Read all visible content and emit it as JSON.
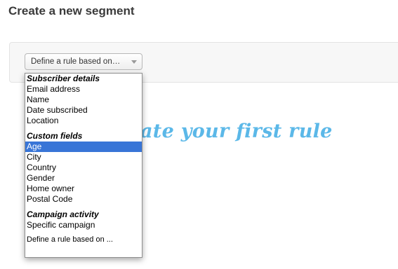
{
  "page": {
    "title": "Create a new segment"
  },
  "rule_select": {
    "value": "Define a rule based on…"
  },
  "hint_text": "ate your first rule",
  "dropdown": {
    "groups": [
      {
        "label": "Subscriber details",
        "options": [
          "Email address",
          "Name",
          "Date subscribed",
          "Location"
        ]
      },
      {
        "label": "Custom fields",
        "options": [
          "Age",
          "City",
          "Country",
          "Gender",
          "Home owner",
          "Postal Code"
        ]
      },
      {
        "label": "Campaign activity",
        "options": [
          "Specific campaign"
        ]
      }
    ],
    "selected": "Age",
    "footer": "Define a rule based on ..."
  },
  "colors": {
    "selected_bg": "#3875d7",
    "hint": "#5bb8e8"
  }
}
